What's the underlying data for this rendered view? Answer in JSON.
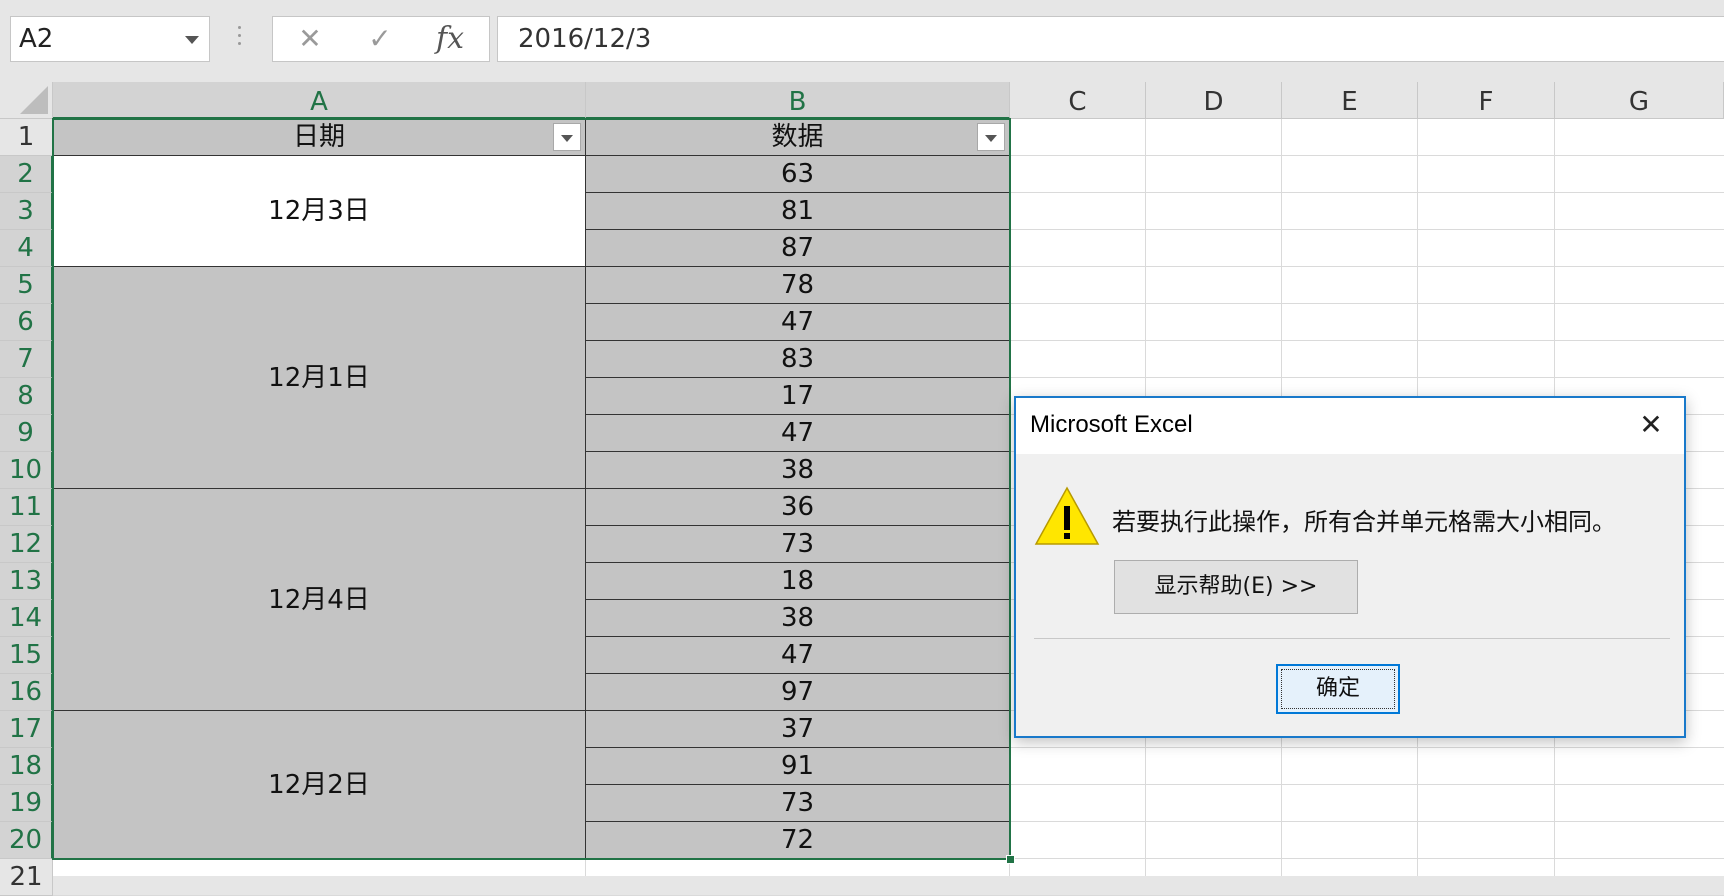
{
  "formula_bar": {
    "name_box": "A2",
    "cancel_glyph": "✕",
    "enter_glyph": "✓",
    "fx_label": "fx",
    "formula_value": "2016/12/3"
  },
  "sheet": {
    "columns": [
      "A",
      "B",
      "C",
      "D",
      "E",
      "F",
      "G"
    ],
    "rows": [
      "1",
      "2",
      "3",
      "4",
      "5",
      "6",
      "7",
      "8",
      "9",
      "10",
      "11",
      "12",
      "13",
      "14",
      "15",
      "16",
      "17",
      "18",
      "19",
      "20",
      "21"
    ],
    "headers": {
      "a": "日期",
      "b": "数据"
    },
    "date_groups": [
      "12月3日",
      "12月1日",
      "12月4日",
      "12月2日"
    ],
    "values": [
      "63",
      "81",
      "87",
      "78",
      "47",
      "83",
      "17",
      "47",
      "38",
      "36",
      "73",
      "18",
      "38",
      "47",
      "97",
      "37",
      "91",
      "73",
      "72"
    ]
  },
  "dialog": {
    "title": "Microsoft Excel",
    "close_glyph": "✕",
    "message": "若要执行此操作，所有合并单元格需大小相同。",
    "help_button": "显示帮助(E) >>",
    "ok_button": "确定",
    "icon": "warning-icon"
  },
  "colors": {
    "accent_green": "#217346",
    "selection_fill": "#c4c4c4",
    "dialog_border": "#1979ca",
    "warning_yellow": "#ffe600"
  }
}
